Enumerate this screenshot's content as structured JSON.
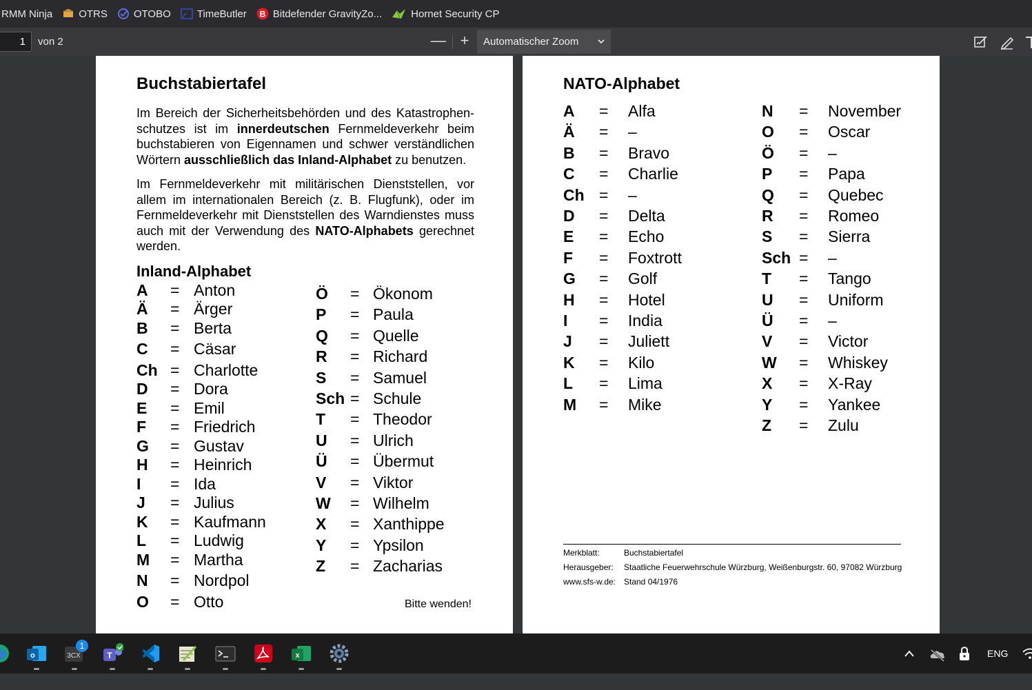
{
  "bookmarks": [
    {
      "label": "RMM Ninja",
      "icon": "none"
    },
    {
      "label": "OTRS",
      "icon": "otrs-icon"
    },
    {
      "label": "OTOBO",
      "icon": "otobo-icon"
    },
    {
      "label": "TimeButler",
      "icon": "timebutler-icon"
    },
    {
      "label": "Bitdefender GravityZo...",
      "icon": "bitdefender-icon"
    },
    {
      "label": "Hornet Security CP",
      "icon": "hornetsecurity-icon"
    }
  ],
  "toolbar": {
    "page_number": "1",
    "page_of": "von 2",
    "zoom_out": "—",
    "zoom_in": "+",
    "zoom_value": "Automatischer Zoom",
    "icons": [
      "edit-signature-icon",
      "draw-pen-icon",
      "text-icon"
    ]
  },
  "page1": {
    "title": "Buchstabiertafel",
    "para1_parts": [
      "Im Bereich der Sicherheitsbehörden und des Katastrophen-schutzes ist im ",
      "innerdeutschen",
      " Fernmeldeverkehr beim buchstabieren von Eigennamen und schwer verständlichen Wörtern ",
      "ausschließlich das Inland-Alphabet",
      " zu benutzen."
    ],
    "para2_parts": [
      "Im Fernmeldeverkehr mit militärischen Dienststellen, vor allem im internationalen Bereich (z. B. Flugfunk), oder im Fernmeldeverkehr mit Dienststellen des Warndienstes muss auch mit der Verwendung des ",
      "NATO-Alphabets",
      " gerechnet werden."
    ],
    "section_title": "Inland-Alphabet",
    "col1": [
      [
        "A",
        "Anton"
      ],
      [
        "Ä",
        "Ärger"
      ],
      [
        "B",
        "Berta"
      ],
      [
        "C",
        "Cäsar"
      ],
      [
        "Ch",
        "Charlotte"
      ],
      [
        "D",
        "Dora"
      ],
      [
        "E",
        "Emil"
      ],
      [
        "F",
        "Friedrich"
      ],
      [
        "G",
        "Gustav"
      ],
      [
        "H",
        "Heinrich"
      ],
      [
        "I",
        "Ida"
      ],
      [
        "J",
        "Julius"
      ],
      [
        "K",
        "Kaufmann"
      ],
      [
        "L",
        "Ludwig"
      ],
      [
        "M",
        "Martha"
      ],
      [
        "N",
        "Nordpol"
      ],
      [
        "O",
        "Otto"
      ]
    ],
    "col2": [
      [
        "Ö",
        "Ökonom"
      ],
      [
        "P",
        "Paula"
      ],
      [
        "Q",
        "Quelle"
      ],
      [
        "R",
        "Richard"
      ],
      [
        "S",
        "Samuel"
      ],
      [
        "Sch",
        "Schule"
      ],
      [
        "T",
        "Theodor"
      ],
      [
        "U",
        "Ulrich"
      ],
      [
        "Ü",
        "Übermut"
      ],
      [
        "V",
        "Viktor"
      ],
      [
        "W",
        "Wilhelm"
      ],
      [
        "X",
        "Xanthippe"
      ],
      [
        "Y",
        "Ypsilon"
      ],
      [
        "Z",
        "Zacharias"
      ]
    ],
    "equals": "=",
    "bitte_wenden": "Bitte wenden!"
  },
  "page2": {
    "title": "NATO-Alphabet",
    "col1": [
      [
        "A",
        "Alfa"
      ],
      [
        "Ä",
        "–"
      ],
      [
        "B",
        "Bravo"
      ],
      [
        "C",
        "Charlie"
      ],
      [
        "Ch",
        "–"
      ],
      [
        "D",
        "Delta"
      ],
      [
        "E",
        "Echo"
      ],
      [
        "F",
        "Foxtrott"
      ],
      [
        "G",
        "Golf"
      ],
      [
        "H",
        "Hotel"
      ],
      [
        "I",
        "India"
      ],
      [
        "J",
        "Juliett"
      ],
      [
        "K",
        "Kilo"
      ],
      [
        "L",
        "Lima"
      ],
      [
        "M",
        "Mike"
      ]
    ],
    "col2": [
      [
        "N",
        "November"
      ],
      [
        "O",
        "Oscar"
      ],
      [
        "Ö",
        "–"
      ],
      [
        "P",
        "Papa"
      ],
      [
        "Q",
        "Quebec"
      ],
      [
        "R",
        "Romeo"
      ],
      [
        "S",
        "Sierra"
      ],
      [
        "Sch",
        "–"
      ],
      [
        "T",
        "Tango"
      ],
      [
        "U",
        "Uniform"
      ],
      [
        "Ü",
        "–"
      ],
      [
        "V",
        "Victor"
      ],
      [
        "W",
        "Whiskey"
      ],
      [
        "X",
        "X-Ray"
      ],
      [
        "Y",
        "Yankee"
      ],
      [
        "Z",
        "Zulu"
      ]
    ],
    "footer": {
      "merkblatt_label": "Merkblatt:",
      "merkblatt_value": "Buchstabiertafel",
      "herausgeber_label": "Herausgeber:",
      "herausgeber_value": "Staatliche Feuerwehrschule Würzburg, Weißenburgstr. 60, 97082 Würzburg",
      "web_label": "www.sfs-w.de:",
      "web_value": "Stand 04/1976"
    }
  },
  "taskbar": {
    "apps": [
      "edge-icon",
      "outlook-icon",
      "3cx-icon",
      "teams-icon",
      "vscode-icon",
      "notepadpp-icon",
      "terminal-icon",
      "acrobat-icon",
      "excel-icon",
      "settings-icon"
    ],
    "badge_3cx": "1",
    "tray_language": "ENG",
    "tray_icons": [
      "chevron-up-icon",
      "onedrive-icon",
      "lock-icon",
      "wifi-icon"
    ]
  },
  "colors": {
    "bookmarks_bg": "#2b2b2f",
    "toolbar_bg": "#38383d",
    "viewer_bg": "#323639",
    "taskbar_bg": "#1c1c1c"
  }
}
